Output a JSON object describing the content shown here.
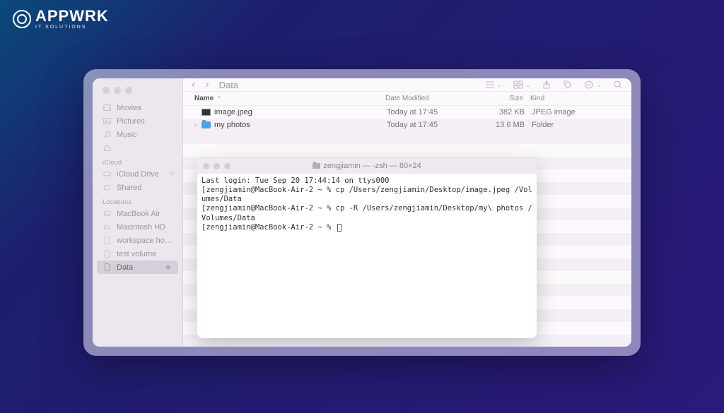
{
  "brand": {
    "name": "APPWRK",
    "tagline": "IT SOLUTIONS"
  },
  "finder": {
    "title": "Data",
    "sidebar": {
      "favorites": [
        {
          "label": "Movies",
          "icon": "film"
        },
        {
          "label": "Pictures",
          "icon": "picture"
        },
        {
          "label": "Music",
          "icon": "music"
        },
        {
          "label": "",
          "icon": "home"
        }
      ],
      "icloud_header": "iCloud",
      "icloud": [
        {
          "label": "iCloud Drive",
          "icon": "cloud",
          "badge": "sync"
        },
        {
          "label": "Shared",
          "icon": "shared"
        }
      ],
      "locations_header": "Locations",
      "locations": [
        {
          "label": "MacBook Air",
          "icon": "laptop"
        },
        {
          "label": "Macintosh HD",
          "icon": "disk"
        },
        {
          "label": "workspace ho…",
          "icon": "doc"
        },
        {
          "label": "test volume",
          "icon": "doc"
        },
        {
          "label": "Data",
          "icon": "doc",
          "selected": true,
          "eject": true
        }
      ]
    },
    "columns": {
      "name": "Name",
      "date": "Date Modified",
      "size": "Size",
      "kind": "Kind"
    },
    "rows": [
      {
        "name": "image.jpeg",
        "date": "Today at 17:45",
        "size": "382 KB",
        "kind": "JPEG image",
        "type": "file"
      },
      {
        "name": "my photos",
        "date": "Today at 17:45",
        "size": "13.6 MB",
        "kind": "Folder",
        "type": "folder"
      }
    ]
  },
  "terminal": {
    "title": "zengjiamin — -zsh — 80×24",
    "lines": [
      "Last login: Tue Sep 20 17:44:14 on ttys000",
      "[zengjiamin@MacBook-Air-2 ~ % cp /Users/zengjiamin/Desktop/image.jpeg /Volumes/Data",
      "[zengjiamin@MacBook-Air-2 ~ % cp -R /Users/zengjiamin/Desktop/my\\ photos /Volumes/Data",
      "[zengjiamin@MacBook-Air-2 ~ % "
    ]
  }
}
